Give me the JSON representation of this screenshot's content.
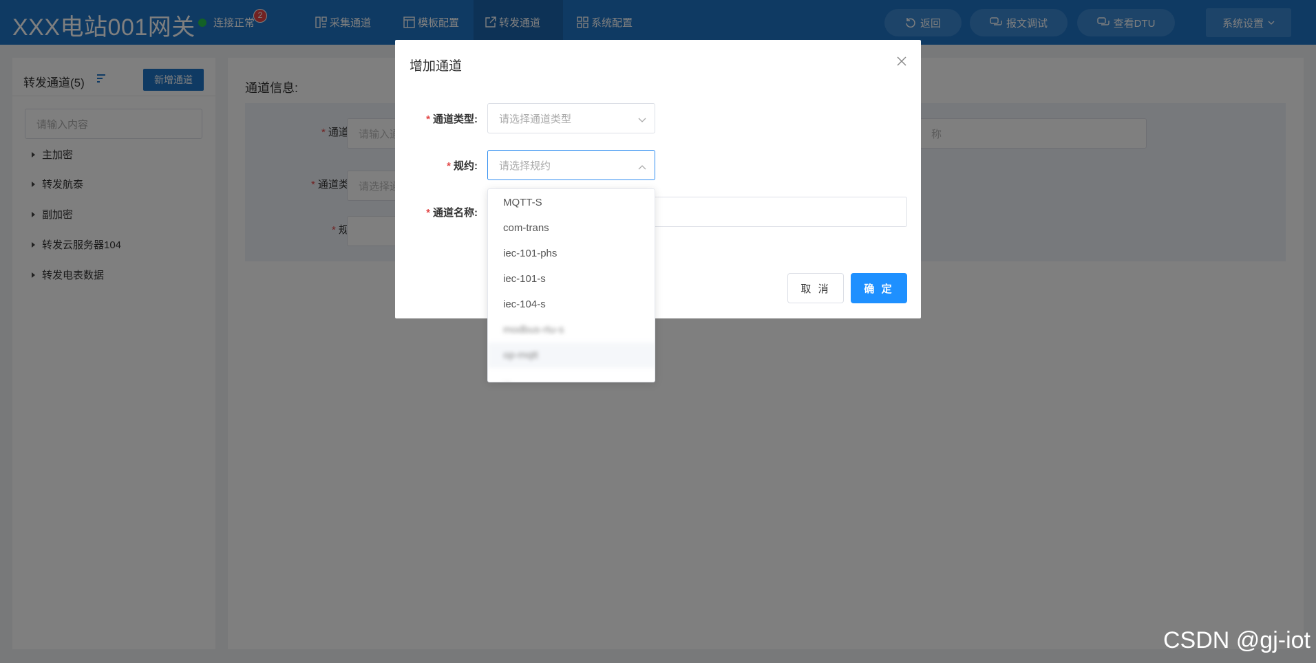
{
  "header": {
    "title": "XXX电站001网关",
    "status_text": "连接正常",
    "badge_count": "2",
    "status_color": "#27c24c",
    "nav": [
      {
        "label": "采集通道",
        "icon": "collect-icon"
      },
      {
        "label": "模板配置",
        "icon": "template-icon"
      },
      {
        "label": "转发通道",
        "icon": "forward-icon",
        "active": true
      },
      {
        "label": "系统配置",
        "icon": "grid-icon"
      }
    ],
    "actions": [
      {
        "label": "返回",
        "icon": "refresh-back-icon"
      },
      {
        "label": "报文调试",
        "icon": "chat-icon"
      },
      {
        "label": "查看DTU",
        "icon": "chat-icon"
      }
    ],
    "settings_label": "系统设置"
  },
  "sidebar": {
    "title": "转发通道(5)",
    "new_button": "新增通道",
    "search_placeholder": "请输入内容",
    "items": [
      "主加密",
      "转发航泰",
      "副加密",
      "转发云服务器104",
      "转发电表数据"
    ]
  },
  "main": {
    "title": "通道信息:",
    "fields": [
      {
        "label": "通道号:",
        "placeholder": "请输入通"
      },
      {
        "label": "通道类型:",
        "placeholder": "请选择通"
      },
      {
        "label": "规约:",
        "placeholder": ""
      }
    ],
    "right_field_placeholder": "称"
  },
  "dialog": {
    "title": "增加通道",
    "fields": [
      {
        "label": "通道类型:",
        "placeholder": "请选择通道类型"
      },
      {
        "label": "规约:",
        "placeholder": "请选择规约"
      },
      {
        "label": "通道名称:",
        "placeholder": ""
      }
    ],
    "cancel": "取 消",
    "confirm": "确 定"
  },
  "dropdown": {
    "options": [
      "MQTT-S",
      "com-trans",
      "iec-101-phs",
      "iec-101-s",
      "iec-104-s",
      "modbus-rtu-s",
      "op-mqtt",
      "..."
    ],
    "hovered_index": 6
  },
  "watermark": "CSDN @gj-iot",
  "colors": {
    "brand": "#1f74c6",
    "primary": "#1e90ff",
    "required": "#e24545"
  }
}
